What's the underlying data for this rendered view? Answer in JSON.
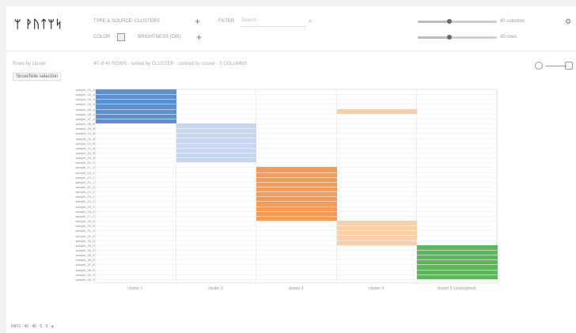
{
  "app": {
    "logo": "ᛘ ᚹᚢᛏᛘᛋ"
  },
  "header": {
    "type_label": "TYPE & SOURCE: CLUSTERS",
    "filter_label": "FILTER",
    "search_placeholder": "Search",
    "color_label": "COLOR",
    "sort_label": "BRIGHTNESS (DBI)",
    "slider1_label": "40 columns",
    "slider2_label": "40 rows",
    "slider1_value": 0.4,
    "slider2_value": 0.4
  },
  "subbar": {
    "left_label": "Rows by cluster",
    "link_label": "Show/hide selection",
    "desc": "40 of 40 ROWS · sorted by CLUSTER · colored by cluster · 5 COLUMNS"
  },
  "heatmap": {
    "columns": [
      "cluster 1",
      "cluster 2",
      "cluster 3",
      "cluster 4",
      "cluster 5 (unassigned)"
    ],
    "colors": [
      "#5b8fcf",
      "#c6d6ee",
      "#f59a55",
      "#f9cfa8",
      "#5fb55e"
    ],
    "blocks": [
      {
        "col": 0,
        "row_start": 0,
        "row_end": 7,
        "color_index": 0
      },
      {
        "col": 3,
        "row_start": 4,
        "row_end": 5,
        "color_index": 3
      },
      {
        "col": 1,
        "row_start": 7,
        "row_end": 15,
        "color_index": 1
      },
      {
        "col": 2,
        "row_start": 16,
        "row_end": 27,
        "color_index": 2
      },
      {
        "col": 3,
        "row_start": 27,
        "row_end": 32,
        "color_index": 3
      },
      {
        "col": 4,
        "row_start": 32,
        "row_end": 39,
        "color_index": 4
      }
    ],
    "row_count": 40,
    "row_labels": [
      "sample_01_A",
      "sample_02_A",
      "sample_03_A",
      "sample_04_A",
      "sample_05_A",
      "sample_06_A",
      "sample_07_A",
      "sample_08_B",
      "sample_09_B",
      "sample_10_B",
      "sample_11_B",
      "sample_12_B",
      "sample_13_B",
      "sample_14_B",
      "sample_15_B",
      "sample_16_C",
      "sample_17_C",
      "sample_18_C",
      "sample_19_C",
      "sample_20_C",
      "sample_21_C",
      "sample_22_C",
      "sample_23_C",
      "sample_24_C",
      "sample_25_C",
      "sample_26_C",
      "sample_27_C",
      "sample_28_D",
      "sample_29_D",
      "sample_30_D",
      "sample_31_D",
      "sample_32_D",
      "sample_33_E",
      "sample_34_E",
      "sample_35_E",
      "sample_36_E",
      "sample_37_E",
      "sample_38_E",
      "sample_39_E",
      "sample_40_E"
    ]
  },
  "footer": {
    "text": "INFO · 40 · 40 · 5 · 5 ·",
    "status": "●"
  }
}
